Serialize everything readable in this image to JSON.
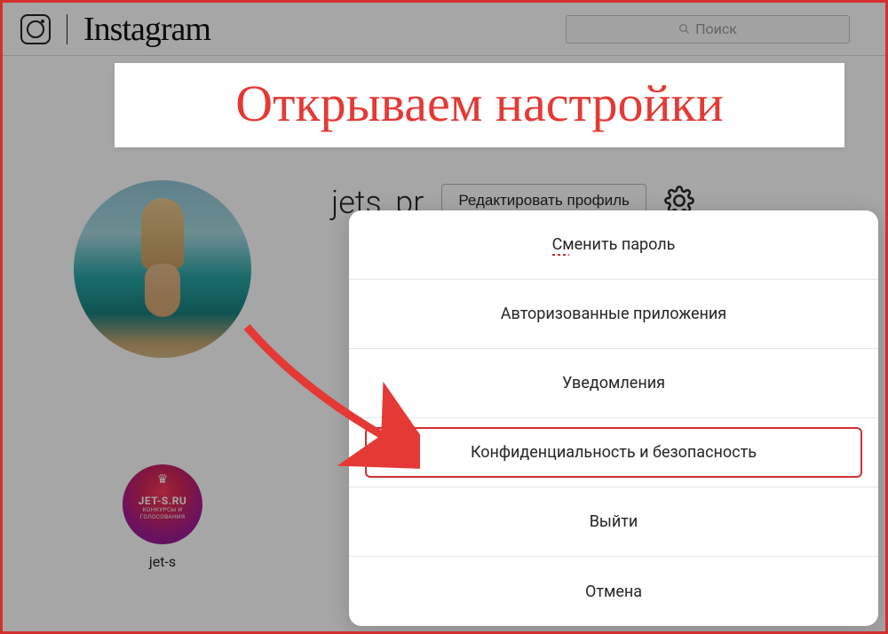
{
  "brand": {
    "wordmark": "Instagram"
  },
  "search": {
    "placeholder": "Поиск"
  },
  "profile": {
    "username": "jets_pr",
    "edit_label": "Редактировать профиль"
  },
  "highlights": [
    {
      "badge_title": "JET-S.RU",
      "badge_sub": "КОНКУРСЫ И ГОЛОСОВАНИЯ",
      "label": "jet-s"
    }
  ],
  "settings_menu": {
    "items": [
      {
        "label": "Сменить пароль",
        "highlighted": false,
        "spellmark": true
      },
      {
        "label": "Авторизованные приложения",
        "highlighted": false,
        "spellmark": false
      },
      {
        "label": "Уведомления",
        "highlighted": false,
        "spellmark": false
      },
      {
        "label": "Конфиденциальность и безопасность",
        "highlighted": true,
        "spellmark": false
      },
      {
        "label": "Выйти",
        "highlighted": false,
        "spellmark": false
      },
      {
        "label": "Отмена",
        "highlighted": false,
        "spellmark": false
      }
    ]
  },
  "annotation": {
    "banner_text": "Открываем настройки"
  },
  "colors": {
    "accent_red": "#e53935",
    "highlight_border": "#d32f2f"
  }
}
